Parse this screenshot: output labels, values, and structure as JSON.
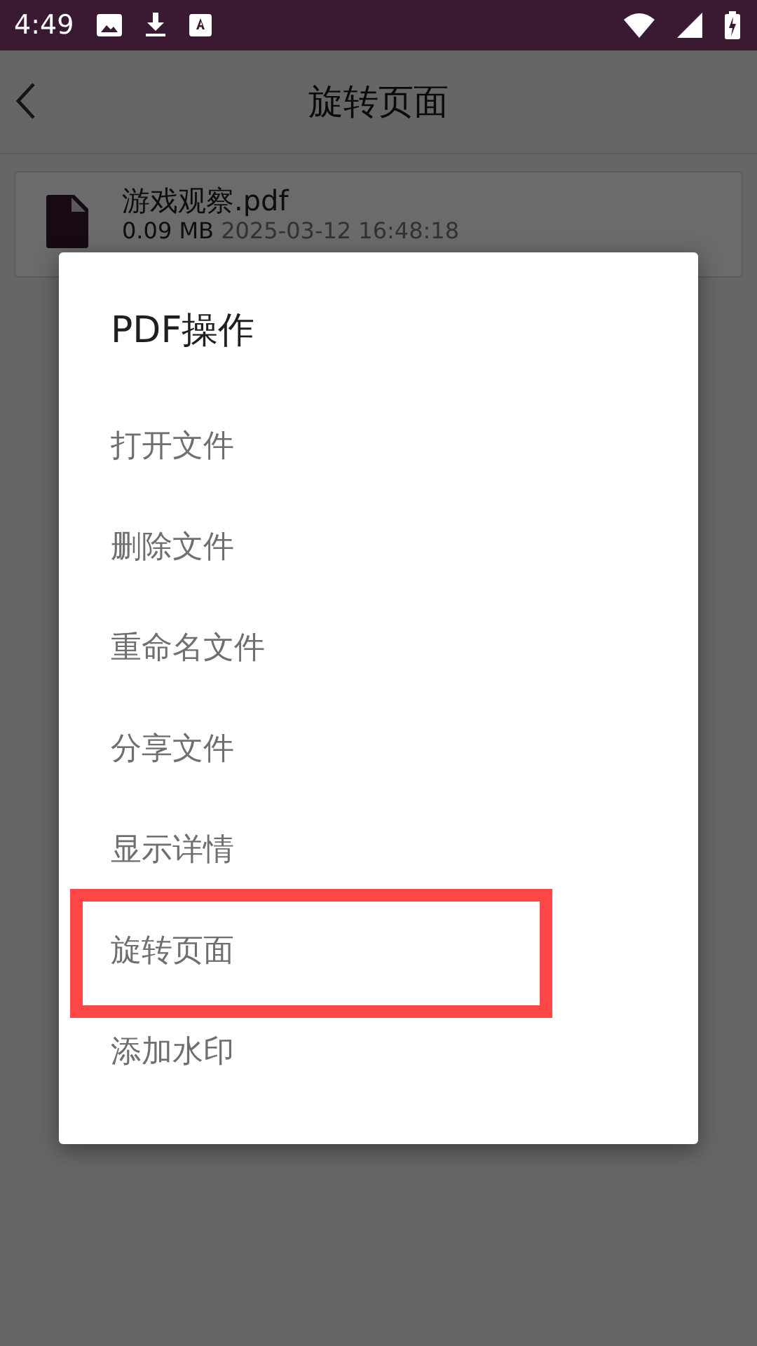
{
  "status_bar": {
    "time": "4:49"
  },
  "app_bar": {
    "title": "旋转页面"
  },
  "file": {
    "name": "游戏观察.pdf",
    "size": "0.09 MB",
    "date": "2025-03-12 16:48:18"
  },
  "dialog": {
    "title": "PDF操作",
    "items": [
      {
        "label": "打开文件",
        "highlighted": false
      },
      {
        "label": "删除文件",
        "highlighted": false
      },
      {
        "label": "重命名文件",
        "highlighted": false
      },
      {
        "label": "分享文件",
        "highlighted": false
      },
      {
        "label": "显示详情",
        "highlighted": false
      },
      {
        "label": "旋转页面",
        "highlighted": true
      },
      {
        "label": "添加水印",
        "highlighted": false
      }
    ]
  }
}
